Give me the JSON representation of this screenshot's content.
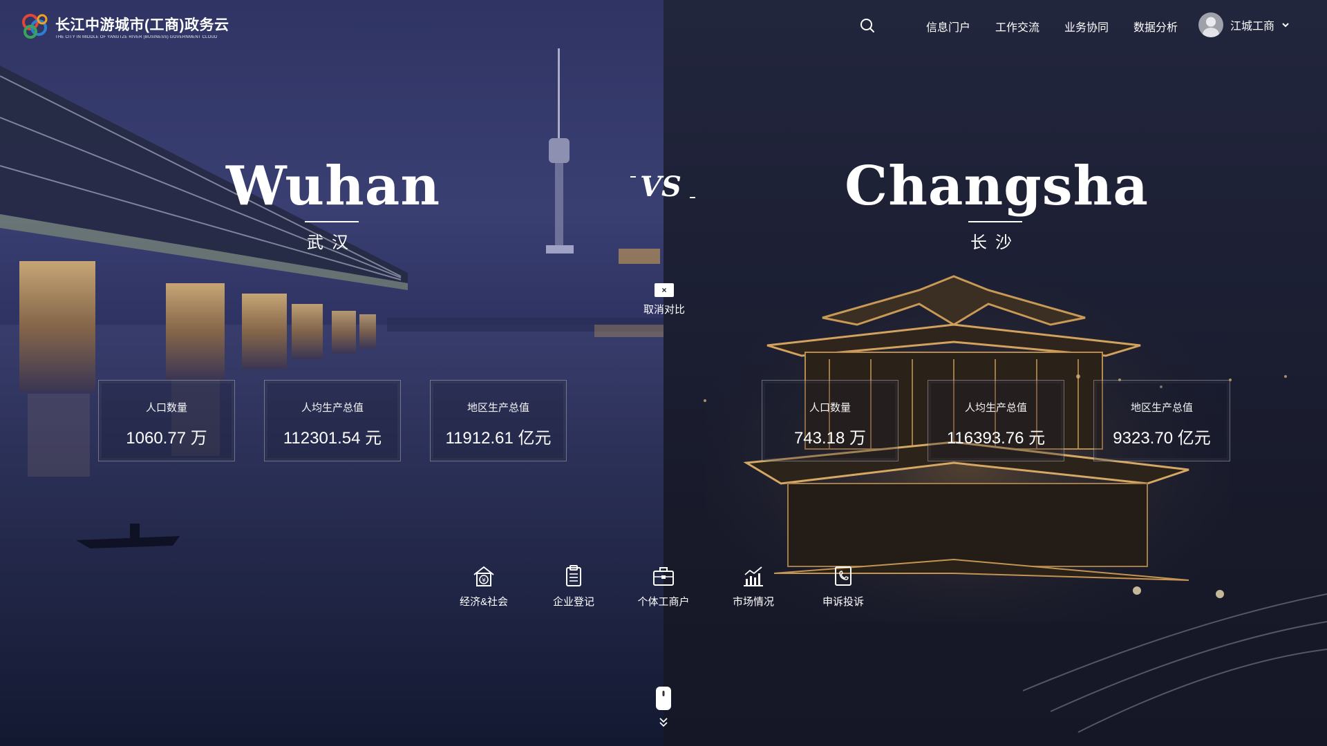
{
  "header": {
    "logo_title": "长江中游城市(工商)政务云",
    "logo_subtitle": "THE CITY IN MIDDLE OF YANGTZE RIVER (BUSINESS) GOVERNMENT CLOUD",
    "nav": [
      "信息门户",
      "工作交流",
      "业务协同",
      "数据分析"
    ],
    "user_name": "江城工商"
  },
  "compare": {
    "vs_label": "VS",
    "cancel_label": "取消对比",
    "cancel_icon": "×"
  },
  "cities": [
    {
      "name_en": "Wuhan",
      "name_cn": "武汉",
      "stats": [
        {
          "label": "人口数量",
          "value": "1060.77 万"
        },
        {
          "label": "人均生产总值",
          "value": "112301.54 元"
        },
        {
          "label": "地区生产总值",
          "value": "11912.61 亿元"
        }
      ]
    },
    {
      "name_en": "Changsha",
      "name_cn": "长沙",
      "stats": [
        {
          "label": "人口数量",
          "value": "743.18 万"
        },
        {
          "label": "人均生产总值",
          "value": "116393.76 元"
        },
        {
          "label": "地区生产总值",
          "value": "9323.70 亿元"
        }
      ]
    }
  ],
  "bottom_nav": [
    {
      "label": "经济&社会",
      "icon": "house-yen-icon"
    },
    {
      "label": "企业登记",
      "icon": "clipboard-icon"
    },
    {
      "label": "个体工商户",
      "icon": "briefcase-icon"
    },
    {
      "label": "市场情况",
      "icon": "bar-chart-icon"
    },
    {
      "label": "申诉投诉",
      "icon": "phone-doc-icon"
    }
  ],
  "colors": {
    "left_bg": "#2f3464",
    "right_bg": "#1c1f33",
    "text": "#ffffff"
  }
}
